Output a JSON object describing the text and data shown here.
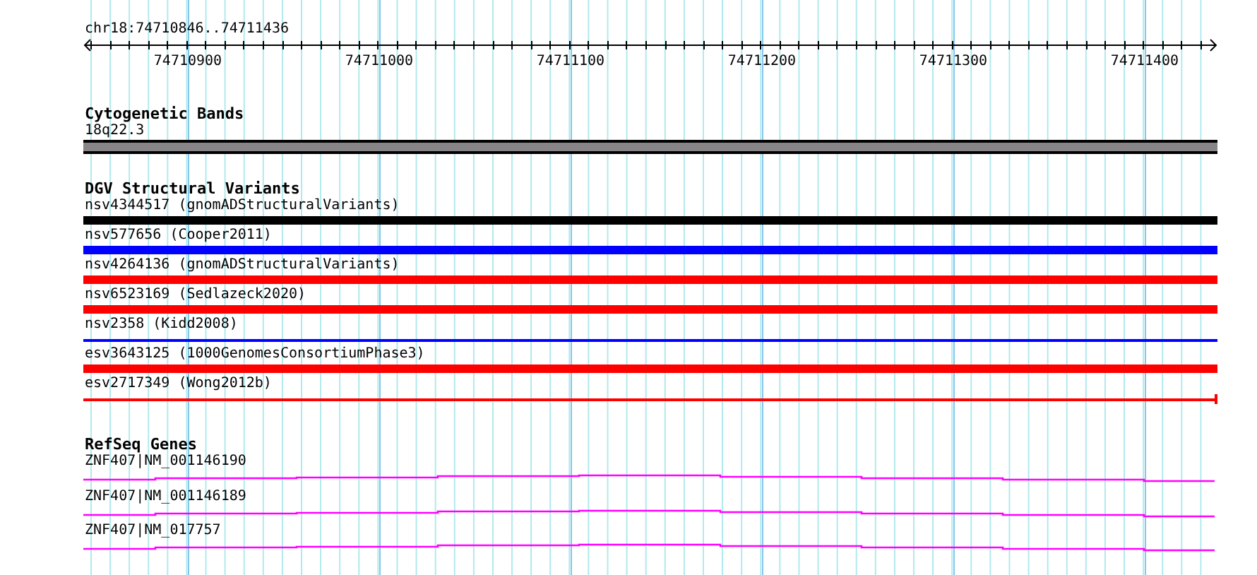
{
  "ruler": {
    "location": "chr18:74710846..74711436",
    "ticks": [
      "74710900",
      "74711000",
      "74711100",
      "74711200",
      "74711300",
      "74711400"
    ]
  },
  "cytogenetic_bands": {
    "title": "Cytogenetic Bands",
    "band": "18q22.3"
  },
  "dgv_structural_variants": {
    "title": "DGV Structural Variants",
    "items": [
      {
        "label": "nsv4344517 (gnomADStructuralVariants)",
        "kind": "thick",
        "color": "#000000",
        "end_mark": false
      },
      {
        "label": "nsv577656 (Cooper2011)",
        "kind": "thick",
        "color": "#0000ff",
        "end_mark": false
      },
      {
        "label": "nsv4264136 (gnomADStructuralVariants)",
        "kind": "thick",
        "color": "#ff0000",
        "end_mark": false
      },
      {
        "label": "nsv6523169 (Sedlazeck2020)",
        "kind": "thick",
        "color": "#ff0000",
        "end_mark": false
      },
      {
        "label": "nsv2358 (Kidd2008)",
        "kind": "thin",
        "color": "#0000ff",
        "end_mark": false
      },
      {
        "label": "esv3643125 (1000GenomesConsortiumPhase3)",
        "kind": "thick",
        "color": "#ff0000",
        "end_mark": false
      },
      {
        "label": "esv2717349 (Wong2012b)",
        "kind": "thin",
        "color": "#ff0000",
        "end_mark": true
      }
    ]
  },
  "refseq_genes": {
    "title": "RefSeq Genes",
    "items": [
      {
        "label": "ZNF407|NM_001146190"
      },
      {
        "label": "ZNF407|NM_001146189"
      },
      {
        "label": "ZNF407|NM_017757"
      }
    ]
  }
}
